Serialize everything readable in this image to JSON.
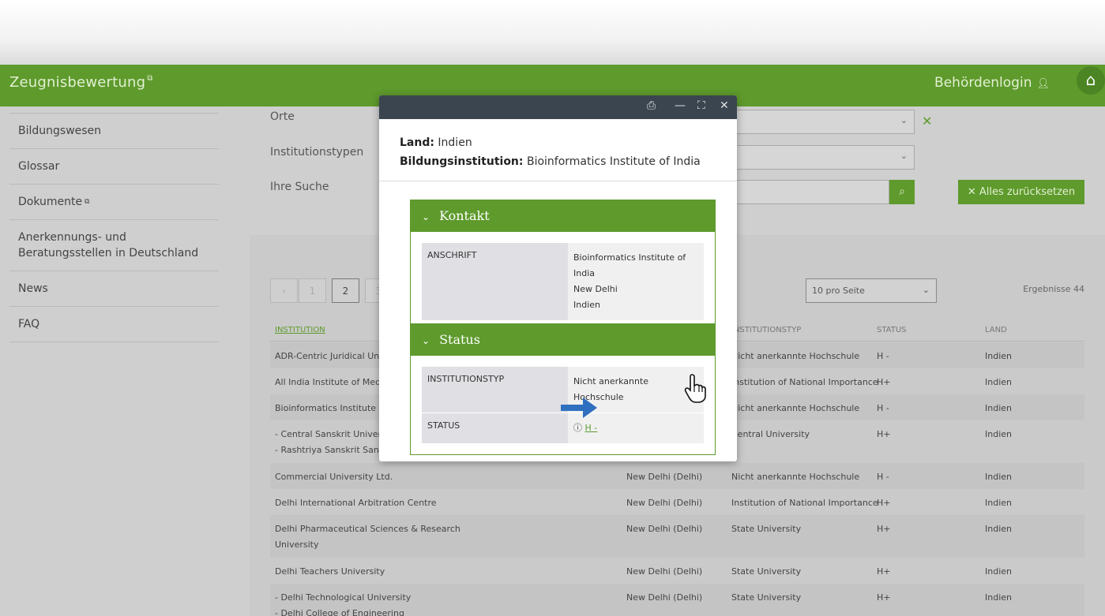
{
  "header": {
    "brand": "Zeugnisbewertung",
    "login": "Behördenlogin"
  },
  "sidebar": {
    "items": [
      {
        "label": "Bildungswesen"
      },
      {
        "label": "Glossar"
      },
      {
        "label": "Dokumente"
      },
      {
        "label": "Anerkennungs- und Beratungsstellen in Deutschland"
      },
      {
        "label": "News"
      },
      {
        "label": "FAQ"
      }
    ]
  },
  "filters": {
    "orte_label": "Orte",
    "institutionstypen_label": "Institutionstypen",
    "suche_label": "Ihre Suche",
    "reset_label": "Alles zurücksetzen"
  },
  "results": {
    "pages": [
      "‹",
      "1",
      "2",
      "3"
    ],
    "per_page": "10 pro Seite",
    "count": "Ergebnisse 44",
    "columns": {
      "institution": "INSTITUTION",
      "institutionstyp": "INSTITUTIONSTYP",
      "status": "STATUS",
      "land": "LAND"
    },
    "rows": [
      {
        "institution": "ADR-Centric Juridical Unive",
        "ort": "",
        "typ": "Nicht anerkannte Hochschule",
        "status": "H -",
        "land": "Indien"
      },
      {
        "institution": "All India Institute of Medic",
        "ort": "",
        "typ": "Institution of National Importance",
        "status": "H+",
        "land": "Indien"
      },
      {
        "institution": "Bioinformatics Institute of",
        "ort": "",
        "typ": "Nicht anerkannte Hochschule",
        "status": "H -",
        "land": "Indien"
      },
      {
        "institution": "- Central Sanskrit Universit",
        "institution2": "- Rashtriya Sanskrit Sansth",
        "ort": "",
        "typ": "Central University",
        "status": "H+",
        "land": "Indien"
      },
      {
        "institution": "Commercial University Ltd.",
        "ort": "New Delhi (Delhi)",
        "typ": "Nicht anerkannte Hochschule",
        "status": "H -",
        "land": "Indien"
      },
      {
        "institution": "Delhi International Arbitration Centre",
        "ort": "New Delhi (Delhi)",
        "typ": "Institution of National Importance",
        "status": "H+",
        "land": "Indien"
      },
      {
        "institution": "Delhi Pharmaceutical Sciences & Research",
        "institution2": "University",
        "ort": "New Delhi (Delhi)",
        "typ": "State University",
        "status": "H+",
        "land": "Indien"
      },
      {
        "institution": "Delhi Teachers University",
        "ort": "New Delhi (Delhi)",
        "typ": "State University",
        "status": "H+",
        "land": "Indien"
      },
      {
        "institution": "- Delhi Technological University",
        "institution2": "- Delhi College of Engineering",
        "ort": "New Delhi (Delhi)",
        "typ": "State University",
        "status": "H+",
        "land": "Indien"
      }
    ]
  },
  "modal": {
    "land_label": "Land:",
    "land_value": "Indien",
    "inst_label": "Bildungsinstitution:",
    "inst_value": "Bioinformatics Institute of India",
    "kontakt": {
      "title": "Kontakt",
      "anschrift_label": "ANSCHRIFT",
      "anschrift_line1": "Bioinformatics Institute of India",
      "anschrift_line2": "New Delhi",
      "anschrift_line3": "Indien"
    },
    "status": {
      "title": "Status",
      "typ_label": "INSTITUTIONSTYP",
      "typ_value": "Nicht anerkannte Hochschule",
      "status_label": "STATUS",
      "status_value": "H -"
    }
  },
  "colors": {
    "accent": "#5e9a2c",
    "modal_bar": "#3a4550",
    "arrow": "#2f6fbf"
  }
}
